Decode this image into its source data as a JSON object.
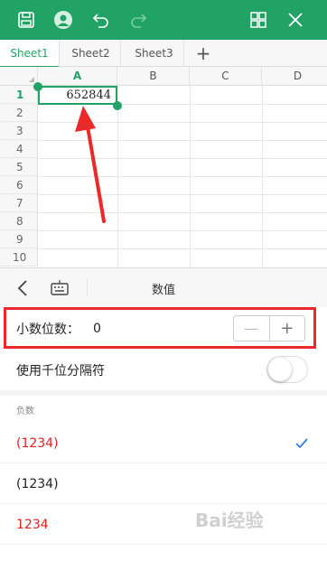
{
  "sheet_tabs": [
    "Sheet1",
    "Sheet2",
    "Sheet3"
  ],
  "add_tab_label": "+",
  "columns": [
    "A",
    "B",
    "C",
    "D"
  ],
  "rows": [
    "1",
    "2",
    "3",
    "4",
    "5",
    "6",
    "7",
    "8",
    "9",
    "10"
  ],
  "cell_a1": "652844",
  "panel": {
    "title": "数值",
    "decimal_label": "小数位数：",
    "decimal_value": "0",
    "minus_label": "—",
    "plus_label": "+",
    "thousand_label": "使用千位分隔符",
    "negative_title": "负数",
    "negative_options": [
      {
        "label": "(1234)",
        "color": "#e02020",
        "selected": true
      },
      {
        "label": "(1234)",
        "color": "#222222",
        "selected": false
      },
      {
        "label": "1234",
        "color": "#e02020",
        "selected": false
      }
    ]
  },
  "watermark": "Bai经验",
  "colors": {
    "accent": "#21a366",
    "highlight": "#ea2a2a",
    "check": "#2f7de1"
  }
}
